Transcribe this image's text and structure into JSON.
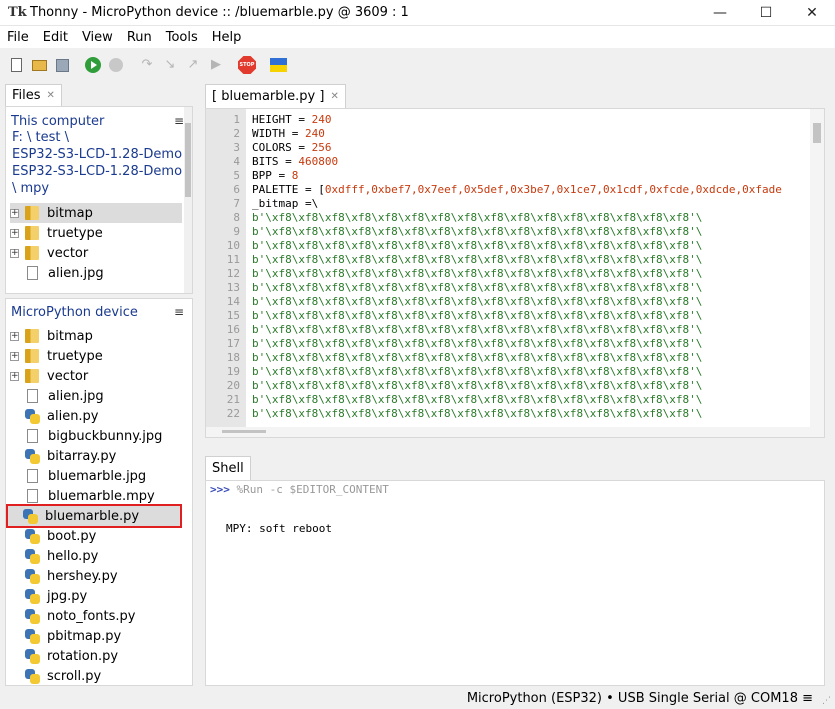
{
  "window": {
    "app_icon": "Tk",
    "title": "Thonny  -  MicroPython device :: /bluemarble.py  @  3609 : 1",
    "minimize": "—",
    "maximize": "☐",
    "close": "✕"
  },
  "menu": [
    "File",
    "Edit",
    "View",
    "Run",
    "Tools",
    "Help"
  ],
  "toolbar": {
    "icons": [
      "new-file-icon",
      "open-file-icon",
      "save-icon",
      "run-icon",
      "debug-icon",
      "step-over-icon",
      "step-into-icon",
      "step-out-icon",
      "resume-icon",
      "stop-icon",
      "ukraine-flag-icon"
    ],
    "stop_label": "STOP"
  },
  "files_tab": {
    "label": "Files",
    "close": "✕"
  },
  "this_computer": {
    "header": "This computer",
    "path_lines": [
      "F: \\ test \\",
      "ESP32-S3-LCD-1.28-Demo \\",
      " ESP32-S3-LCD-1.28-Demo",
      "\\ mpy"
    ],
    "items": [
      {
        "name": "bitmap",
        "type": "folder",
        "selected": true
      },
      {
        "name": "truetype",
        "type": "folder"
      },
      {
        "name": "vector",
        "type": "folder"
      },
      {
        "name": "alien.jpg",
        "type": "file"
      }
    ]
  },
  "device": {
    "header": "MicroPython device",
    "items": [
      {
        "name": "bitmap",
        "type": "folder"
      },
      {
        "name": "truetype",
        "type": "folder"
      },
      {
        "name": "vector",
        "type": "folder"
      },
      {
        "name": "alien.jpg",
        "type": "file"
      },
      {
        "name": "alien.py",
        "type": "py"
      },
      {
        "name": "bigbuckbunny.jpg",
        "type": "file"
      },
      {
        "name": "bitarray.py",
        "type": "py"
      },
      {
        "name": "bluemarble.jpg",
        "type": "file"
      },
      {
        "name": "bluemarble.mpy",
        "type": "file"
      },
      {
        "name": "bluemarble.py",
        "type": "py",
        "selected": true
      },
      {
        "name": "boot.py",
        "type": "py"
      },
      {
        "name": "hello.py",
        "type": "py"
      },
      {
        "name": "hershey.py",
        "type": "py"
      },
      {
        "name": "jpg.py",
        "type": "py"
      },
      {
        "name": "noto_fonts.py",
        "type": "py"
      },
      {
        "name": "pbitmap.py",
        "type": "py"
      },
      {
        "name": "rotation.py",
        "type": "py"
      },
      {
        "name": "scroll.py",
        "type": "py"
      }
    ]
  },
  "editor": {
    "tab_label": "[ bluemarble.py ]",
    "tab_close": "✕",
    "lines": [
      {
        "n": "1",
        "key": "HEIGHT = ",
        "val": "240"
      },
      {
        "n": "2",
        "key": "WIDTH = ",
        "val": "240"
      },
      {
        "n": "3",
        "key": "COLORS = ",
        "val": "256"
      },
      {
        "n": "4",
        "key": "BITS = ",
        "val": "460800"
      },
      {
        "n": "5",
        "key": "BPP = ",
        "val": "8"
      },
      {
        "n": "6",
        "key": "PALETTE = [",
        "val": "0xdfff,0xbef7,0x7eef,0x5def,0x3be7,0x1ce7,0x1cdf,0xfcde,0xdcde,0xfade"
      },
      {
        "n": "7",
        "key": "_bitmap =\\",
        "val": ""
      },
      {
        "n": "8",
        "key": "",
        "val": "b'\\xf8\\xf8\\xf8\\xf8\\xf8\\xf8\\xf8\\xf8\\xf8\\xf8\\xf8\\xf8\\xf8\\xf8\\xf8\\xf8'\\"
      },
      {
        "n": "9",
        "key": "",
        "val": "b'\\xf8\\xf8\\xf8\\xf8\\xf8\\xf8\\xf8\\xf8\\xf8\\xf8\\xf8\\xf8\\xf8\\xf8\\xf8\\xf8'\\"
      },
      {
        "n": "10",
        "key": "",
        "val": "b'\\xf8\\xf8\\xf8\\xf8\\xf8\\xf8\\xf8\\xf8\\xf8\\xf8\\xf8\\xf8\\xf8\\xf8\\xf8\\xf8'\\"
      },
      {
        "n": "11",
        "key": "",
        "val": "b'\\xf8\\xf8\\xf8\\xf8\\xf8\\xf8\\xf8\\xf8\\xf8\\xf8\\xf8\\xf8\\xf8\\xf8\\xf8\\xf8'\\"
      },
      {
        "n": "12",
        "key": "",
        "val": "b'\\xf8\\xf8\\xf8\\xf8\\xf8\\xf8\\xf8\\xf8\\xf8\\xf8\\xf8\\xf8\\xf8\\xf8\\xf8\\xf8'\\"
      },
      {
        "n": "13",
        "key": "",
        "val": "b'\\xf8\\xf8\\xf8\\xf8\\xf8\\xf8\\xf8\\xf8\\xf8\\xf8\\xf8\\xf8\\xf8\\xf8\\xf8\\xf8'\\"
      },
      {
        "n": "14",
        "key": "",
        "val": "b'\\xf8\\xf8\\xf8\\xf8\\xf8\\xf8\\xf8\\xf8\\xf8\\xf8\\xf8\\xf8\\xf8\\xf8\\xf8\\xf8'\\"
      },
      {
        "n": "15",
        "key": "",
        "val": "b'\\xf8\\xf8\\xf8\\xf8\\xf8\\xf8\\xf8\\xf8\\xf8\\xf8\\xf8\\xf8\\xf8\\xf8\\xf8\\xf8'\\"
      },
      {
        "n": "16",
        "key": "",
        "val": "b'\\xf8\\xf8\\xf8\\xf8\\xf8\\xf8\\xf8\\xf8\\xf8\\xf8\\xf8\\xf8\\xf8\\xf8\\xf8\\xf8'\\"
      },
      {
        "n": "17",
        "key": "",
        "val": "b'\\xf8\\xf8\\xf8\\xf8\\xf8\\xf8\\xf8\\xf8\\xf8\\xf8\\xf8\\xf8\\xf8\\xf8\\xf8\\xf8'\\"
      },
      {
        "n": "18",
        "key": "",
        "val": "b'\\xf8\\xf8\\xf8\\xf8\\xf8\\xf8\\xf8\\xf8\\xf8\\xf8\\xf8\\xf8\\xf8\\xf8\\xf8\\xf8'\\"
      },
      {
        "n": "19",
        "key": "",
        "val": "b'\\xf8\\xf8\\xf8\\xf8\\xf8\\xf8\\xf8\\xf8\\xf8\\xf8\\xf8\\xf8\\xf8\\xf8\\xf8\\xf8'\\"
      },
      {
        "n": "20",
        "key": "",
        "val": "b'\\xf8\\xf8\\xf8\\xf8\\xf8\\xf8\\xf8\\xf8\\xf8\\xf8\\xf8\\xf8\\xf8\\xf8\\xf8\\xf8'\\"
      },
      {
        "n": "21",
        "key": "",
        "val": "b'\\xf8\\xf8\\xf8\\xf8\\xf8\\xf8\\xf8\\xf8\\xf8\\xf8\\xf8\\xf8\\xf8\\xf8\\xf8\\xf8'\\"
      },
      {
        "n": "22",
        "key": "",
        "val": "b'\\xf8\\xf8\\xf8\\xf8\\xf8\\xf8\\xf8\\xf8\\xf8\\xf8\\xf8\\xf8\\xf8\\xf8\\xf8\\xf8'\\"
      }
    ]
  },
  "shell": {
    "tab_label": "Shell",
    "prompt": ">>>",
    "command": " %Run -c $EDITOR_CONTENT",
    "output": "MPY: soft reboot"
  },
  "status": {
    "text": "MicroPython (ESP32)  •  USB Single Serial @ COM18  ≡"
  },
  "colors": {
    "selection_outline": "#e02020",
    "path_text": "#1a3a8f",
    "number": "#c73a0e",
    "bytes": "#2a7a2a"
  }
}
